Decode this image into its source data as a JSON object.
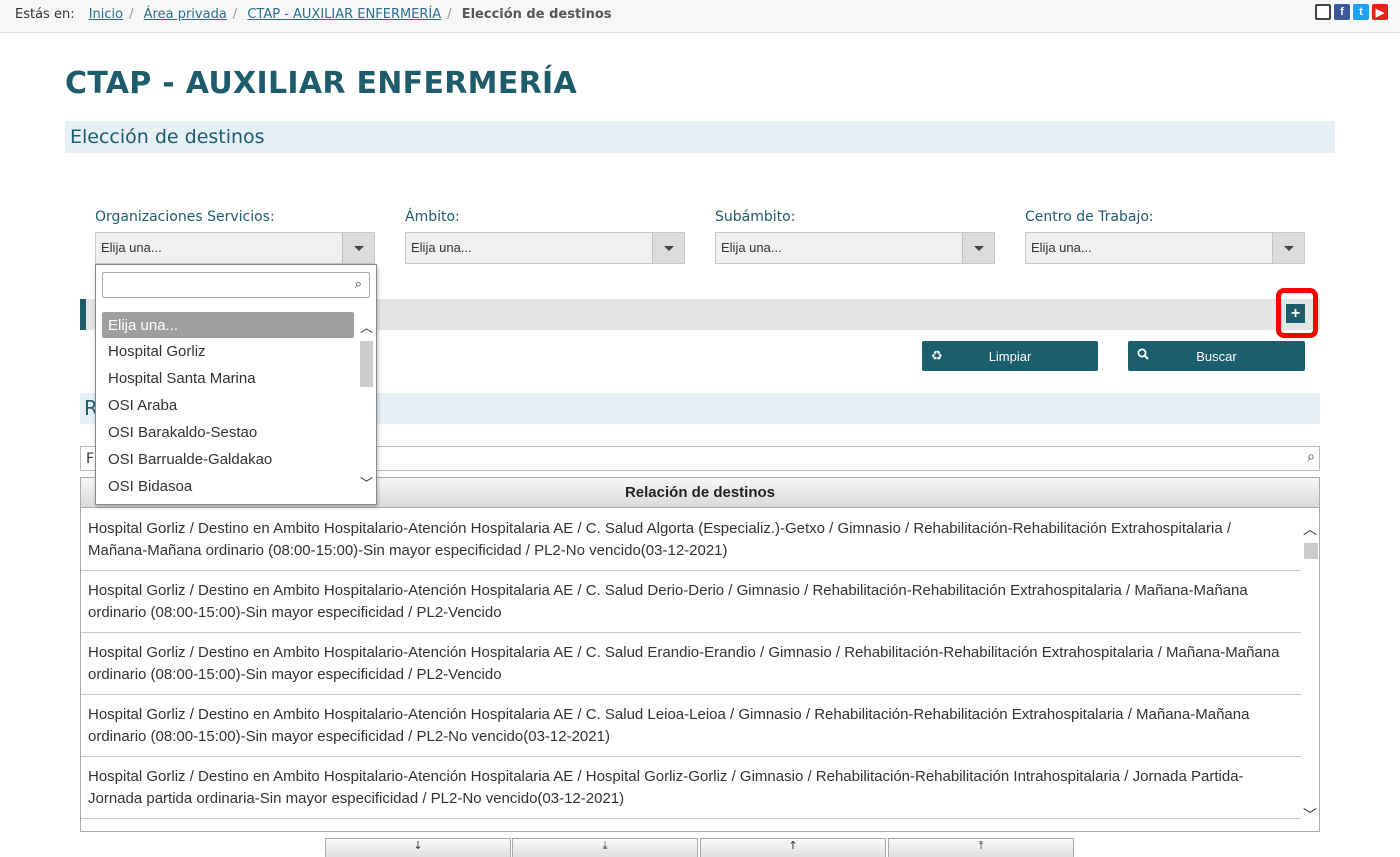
{
  "breadcrumb": {
    "prefix": "Estás en:",
    "items": [
      "Inicio",
      "Área privada",
      "CTAP - AUXILIAR ENFERMERÍA"
    ],
    "current": "Elección de destinos"
  },
  "social": {
    "icons": [
      "tablet-icon",
      "facebook-icon",
      "twitter-icon",
      "youtube-icon"
    ],
    "fb": "f",
    "tw": "t",
    "yt": "▶"
  },
  "page": {
    "title": "CTAP - AUXILIAR ENFERMERÍA",
    "section": "Elección de destinos"
  },
  "filters": [
    {
      "label": "Organizaciones Servicios:",
      "value": "Elija una..."
    },
    {
      "label": "Ámbito:",
      "value": "Elija una..."
    },
    {
      "label": "Subámbito:",
      "value": "Elija una..."
    },
    {
      "label": "Centro de Trabajo:",
      "value": "Elija una..."
    }
  ],
  "buttons": {
    "plus": "+",
    "clear": "Limpiar",
    "search": "Buscar"
  },
  "results": {
    "section_initial": "R",
    "filter_initial": "F"
  },
  "table": {
    "header": "Relación de destinos",
    "rows": [
      "Hospital Gorliz / Destino en Ambito Hospitalario-Atención Hospitalaria AE / C. Salud Algorta (Especializ.)-Getxo / Gimnasio / Rehabilitación-Rehabilitación Extrahospitalaria / Mañana-Mañana ordinario (08:00-15:00)-Sin mayor especificidad / PL2-No vencido(03-12-2021)",
      "Hospital Gorliz / Destino en Ambito Hospitalario-Atención Hospitalaria AE / C. Salud Derio-Derio / Gimnasio / Rehabilitación-Rehabilitación Extrahospitalaria / Mañana-Mañana ordinario (08:00-15:00)-Sin mayor especificidad / PL2-Vencido",
      "Hospital Gorliz / Destino en Ambito Hospitalario-Atención Hospitalaria AE / C. Salud Erandio-Erandio / Gimnasio / Rehabilitación-Rehabilitación Extrahospitalaria / Mañana-Mañana ordinario (08:00-15:00)-Sin mayor especificidad / PL2-Vencido",
      "Hospital Gorliz / Destino en Ambito Hospitalario-Atención Hospitalaria AE / C. Salud Leioa-Leioa / Gimnasio / Rehabilitación-Rehabilitación Extrahospitalaria / Mañana-Mañana ordinario (08:00-15:00)-Sin mayor especificidad / PL2-No vencido(03-12-2021)",
      "Hospital Gorliz / Destino en Ambito Hospitalario-Atención Hospitalaria AE / Hospital Gorliz-Gorliz / Gimnasio / Rehabilitación-Rehabilitación Intrahospitalaria / Jornada Partida-Jornada partida ordinaria-Sin mayor especificidad / PL2-No vencido(03-12-2021)"
    ]
  },
  "pager": [
    "↓",
    "⤓",
    "↑",
    "⤒"
  ],
  "dropdown": {
    "options": [
      "Elija una...",
      "Hospital Gorliz",
      "Hospital Santa Marina",
      "OSI Araba",
      "OSI Barakaldo-Sestao",
      "OSI Barrualde-Galdakao",
      "OSI Bidasoa"
    ],
    "selected": "Elija una..."
  },
  "colors": {
    "accent": "#1e5b6b",
    "link": "#2a6f8f",
    "band": "#e6f0f7",
    "highlight": "#ff0000"
  }
}
